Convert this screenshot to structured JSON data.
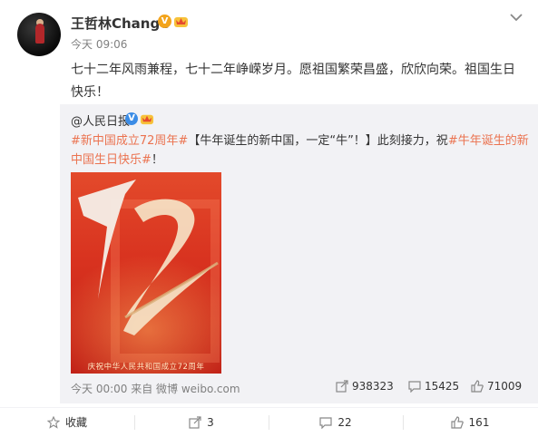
{
  "user": {
    "name": "王哲林Change",
    "time": "今天 09:06",
    "verified_color": "#f3a41c"
  },
  "post": {
    "text": "七十二年风雨兼程，七十二年峥嵘岁月。愿祖国繁荣昌盛，欣欣向荣。祖国生日快乐！"
  },
  "retweet": {
    "author": "@人民日报",
    "verified_color": "#3b8ce6",
    "tag1": "#新中国成立72周年#",
    "text_mid": "【牛年诞生的新中国，一定“牛”！】此刻接力，祝",
    "tag2": "#牛年诞生的新中国生日快乐#",
    "text_end": "！",
    "image_caption": "庆祝中华人民共和国成立72周年",
    "meta": "今天 00:00 来自 微博 weibo.com",
    "reposts": "938323",
    "comments": "15425",
    "likes": "71009"
  },
  "actions": {
    "favorite": "收藏",
    "repost": "3",
    "comment": "22",
    "like": "161"
  },
  "colors": {
    "tag": "#eb7350",
    "poster_red": "#d8321f"
  }
}
